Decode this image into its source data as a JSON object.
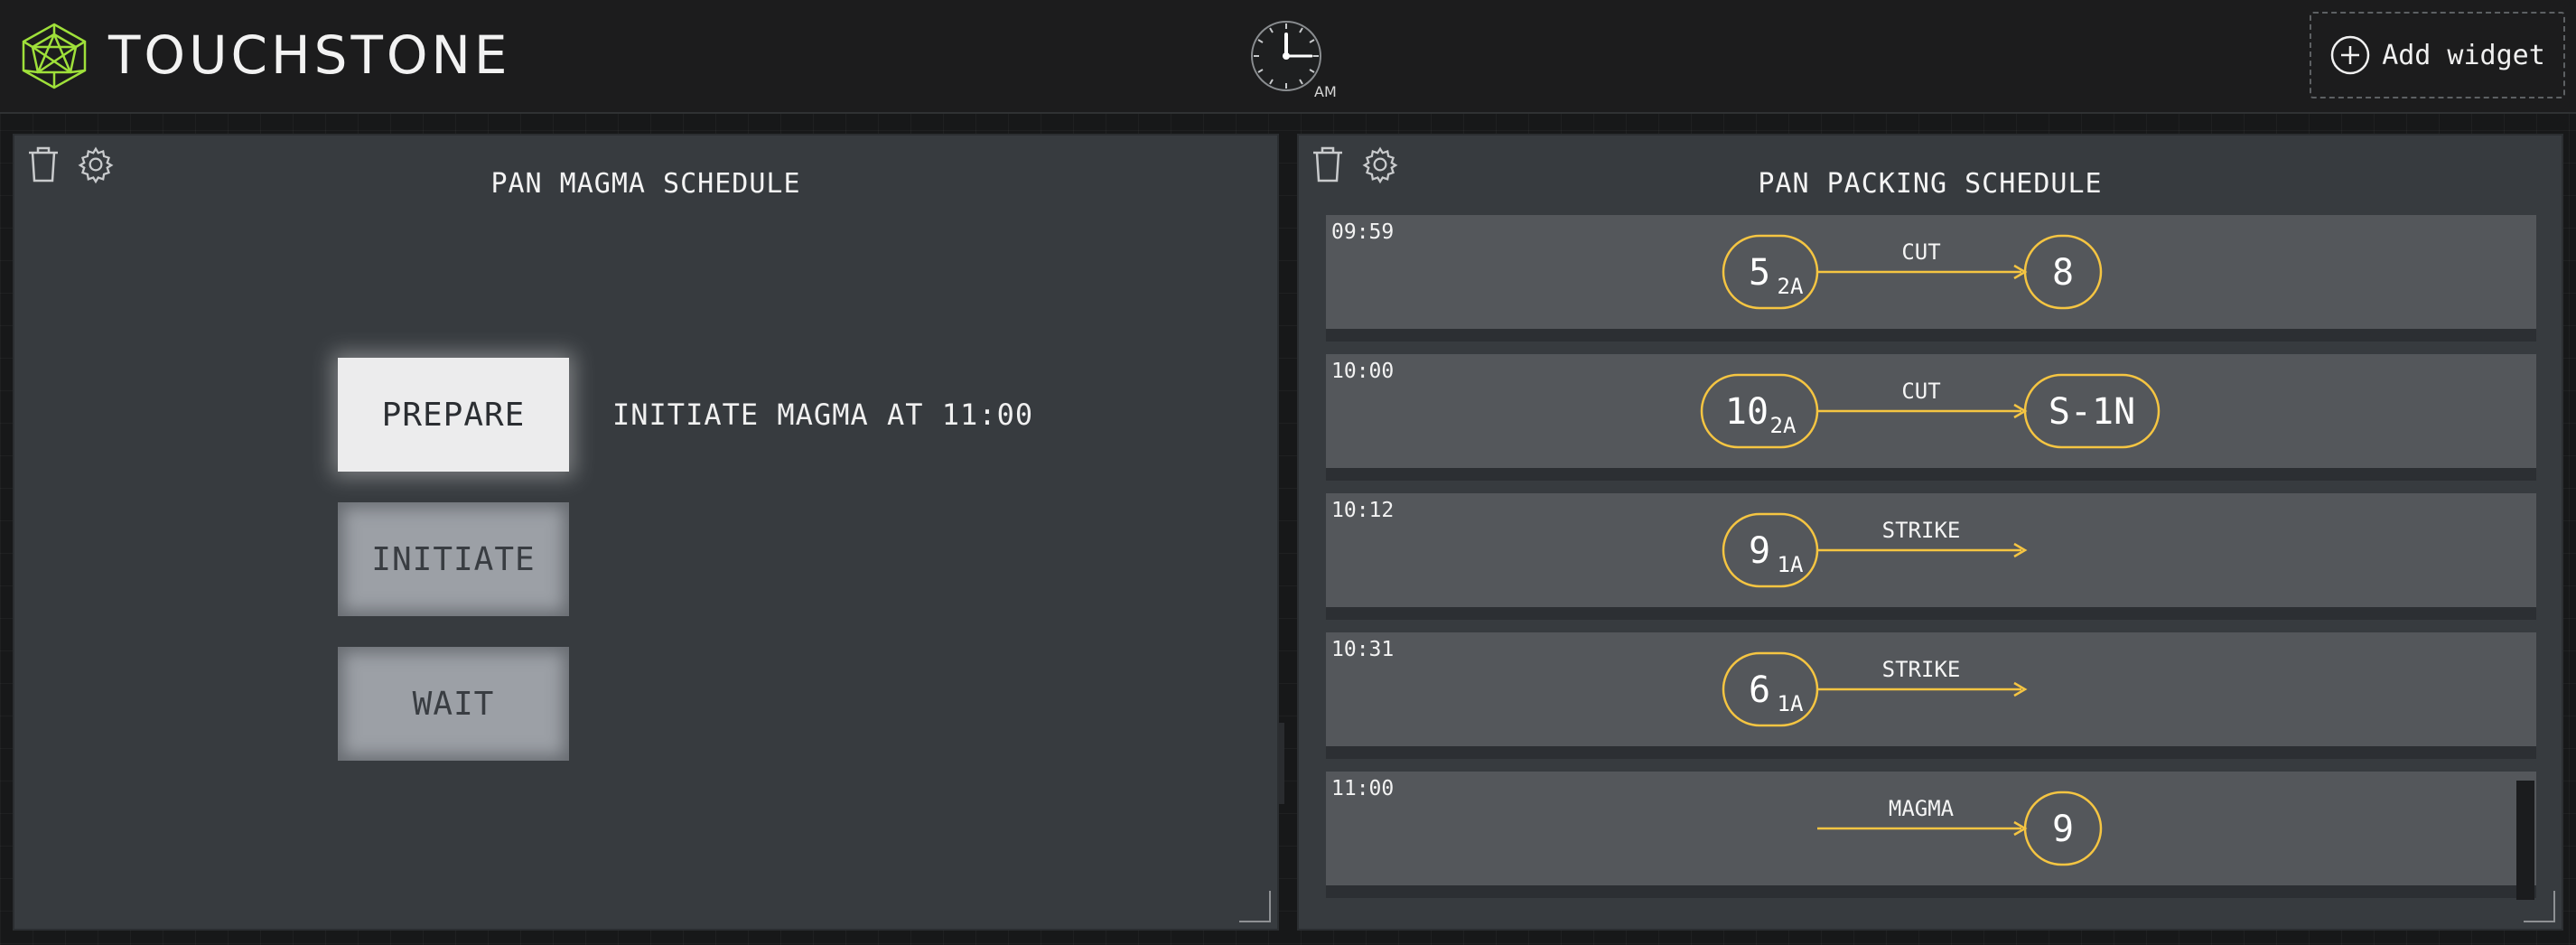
{
  "app": {
    "brand": "TOUCHSTONE",
    "clock_ampm": "AM",
    "add_widget_label": "Add widget"
  },
  "colors": {
    "accent_green": "#9fe03a",
    "flow_yellow": "#f5c542",
    "active_button": "#ececed",
    "inactive_button": "#9ca0a6"
  },
  "left_panel": {
    "title": "PAN MAGMA SCHEDULE",
    "icons": [
      "trash-icon",
      "gear-icon"
    ],
    "buttons": [
      {
        "label": "PREPARE",
        "state": "active"
      },
      {
        "label": "INITIATE",
        "state": "inactive"
      },
      {
        "label": "WAIT",
        "state": "inactive"
      }
    ],
    "status_text": "INITIATE MAGMA AT 11:00"
  },
  "right_panel": {
    "title": "PAN PACKING SCHEDULE",
    "icons": [
      "trash-icon",
      "gear-icon"
    ],
    "rows": [
      {
        "time": "09:59",
        "from_main": "5",
        "from_sub": "2A",
        "op": "CUT",
        "to": "8"
      },
      {
        "time": "10:00",
        "from_main": "10",
        "from_sub": "2A",
        "op": "CUT",
        "to": "S-1N"
      },
      {
        "time": "10:12",
        "from_main": "9",
        "from_sub": "1A",
        "op": "STRIKE",
        "to": ""
      },
      {
        "time": "10:31",
        "from_main": "6",
        "from_sub": "1A",
        "op": "STRIKE",
        "to": ""
      },
      {
        "time": "11:00",
        "from_main": "",
        "from_sub": "",
        "op": "MAGMA",
        "to": "9"
      }
    ]
  }
}
